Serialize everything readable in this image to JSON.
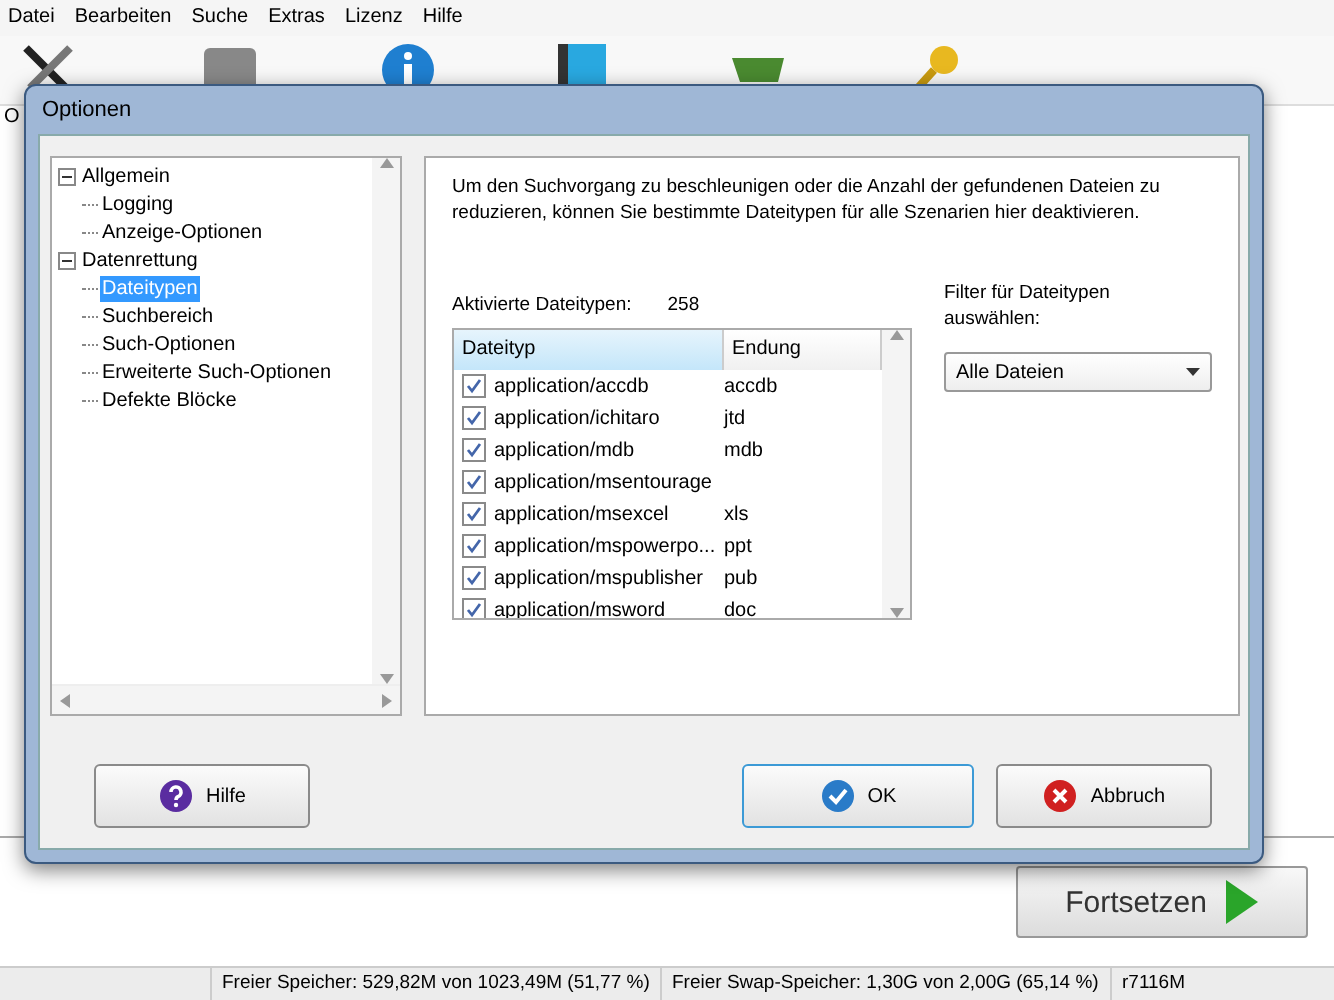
{
  "menu": [
    "Datei",
    "Bearbeiten",
    "Suche",
    "Extras",
    "Lizenz",
    "Hilfe"
  ],
  "background_label": "O",
  "dialog": {
    "title": "Optionen",
    "tree": [
      {
        "label": "Allgemein",
        "expanded": true,
        "selected": false,
        "children": [
          {
            "label": "Logging",
            "selected": false
          },
          {
            "label": "Anzeige-Optionen",
            "selected": false
          }
        ]
      },
      {
        "label": "Datenrettung",
        "expanded": true,
        "selected": false,
        "children": [
          {
            "label": "Dateitypen",
            "selected": true
          },
          {
            "label": "Suchbereich",
            "selected": false
          },
          {
            "label": "Such-Optionen",
            "selected": false
          },
          {
            "label": "Erweiterte Such-Optionen",
            "selected": false
          },
          {
            "label": "Defekte Blöcke",
            "selected": false
          }
        ]
      }
    ],
    "description": "Um den Suchvorgang zu beschleunigen oder die Anzahl der gefundenen Dateien zu reduzieren, können Sie bestimmte Dateitypen für alle Szenarien hier deaktivieren.",
    "active_label": "Aktivierte Dateitypen:",
    "active_count": "258",
    "table": {
      "columns": [
        "Dateityp",
        "Endung"
      ],
      "rows": [
        {
          "type": "application/accdb",
          "ext": "accdb",
          "checked": true
        },
        {
          "type": "application/ichitaro",
          "ext": "jtd",
          "checked": true
        },
        {
          "type": "application/mdb",
          "ext": "mdb",
          "checked": true
        },
        {
          "type": "application/msentourage",
          "ext": "",
          "checked": true
        },
        {
          "type": "application/msexcel",
          "ext": "xls",
          "checked": true
        },
        {
          "type": "application/mspowerpo...",
          "ext": "ppt",
          "checked": true
        },
        {
          "type": "application/mspublisher",
          "ext": "pub",
          "checked": true
        },
        {
          "type": "application/msword",
          "ext": "doc",
          "checked": true
        }
      ]
    },
    "filter_label": "Filter für Dateitypen auswählen:",
    "filter_value": "Alle Dateien",
    "buttons": [
      {
        "kind": "help",
        "label": "Hilfe"
      },
      {
        "kind": "ok",
        "label": "OK"
      },
      {
        "kind": "cancel",
        "label": "Abbruch"
      }
    ]
  },
  "continue_button": "Fortsetzen",
  "status_bar": [
    "Freier Speicher: 529,82M von 1023,49M (51,77 %)",
    "Freier Swap-Speicher: 1,30G von 2,00G (65,14 %)",
    "r7116M"
  ]
}
